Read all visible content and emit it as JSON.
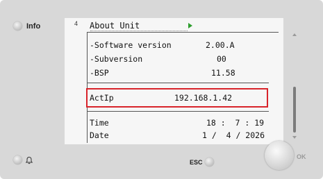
{
  "side": {
    "info_label": "Info"
  },
  "screen": {
    "page_number": "4",
    "title": "About Unit",
    "rows": [
      {
        "label": "-Software version",
        "value": "2.00.A"
      },
      {
        "label": "-Subversion",
        "value": "00"
      },
      {
        "label": "-BSP",
        "value": "11.58"
      }
    ],
    "ip": {
      "label": "ActIp",
      "value": "192.168.1.42"
    },
    "time": {
      "label": "Time",
      "value": "18 :  7 : 19"
    },
    "date": {
      "label": "Date",
      "value": "1 /  4 / 2026"
    }
  },
  "buttons": {
    "esc_label": "ESC",
    "ok_label": "OK"
  },
  "icons": {
    "title_arrow": "play-arrow-icon",
    "alarm": "bell-icon"
  },
  "colors": {
    "highlight_border": "#d8232a",
    "title_arrow": "#2e9e2e"
  }
}
